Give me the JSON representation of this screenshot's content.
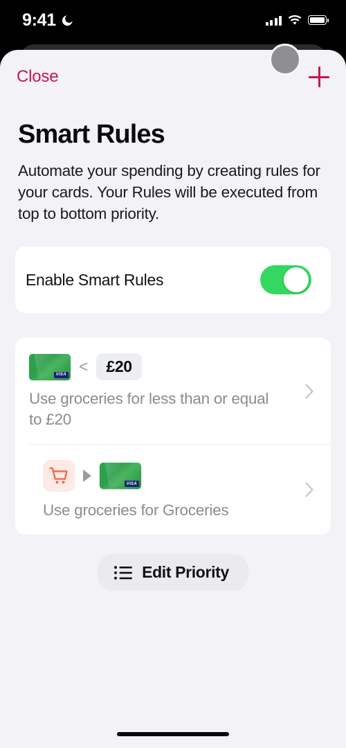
{
  "status_bar": {
    "time": "9:41",
    "dnd_icon": "moon-icon",
    "signal_icon": "cellular-signal-icon",
    "wifi_icon": "wifi-icon",
    "battery_icon": "battery-full-icon"
  },
  "nav": {
    "close_label": "Close",
    "add_icon": "plus-icon",
    "avatar": "user-avatar"
  },
  "header": {
    "title": "Smart Rules",
    "description": "Automate your spending by creating rules for your cards. Your Rules will be executed from top to bottom priority."
  },
  "toggle_section": {
    "label": "Enable Smart Rules",
    "enabled": true,
    "on_color": "#34d860"
  },
  "rules": [
    {
      "card_icon": "green-visa-card-icon",
      "operator": "<",
      "amount": "£20",
      "description": "Use groceries for less than or equal to £20",
      "chevron": "chevron-right-icon"
    },
    {
      "category_icon": "shopping-cart-icon",
      "arrow_icon": "triangle-right-icon",
      "card_icon": "green-visa-card-icon",
      "description": "Use groceries for Groceries",
      "chevron": "chevron-right-icon"
    }
  ],
  "footer": {
    "edit_priority_label": "Edit Priority",
    "edit_priority_icon": "list-bullet-icon"
  },
  "colors": {
    "accent_red": "#c8184b",
    "toggle_green": "#34d860",
    "card_green": "#2ba24a",
    "background": "#f2f2f7",
    "muted_text": "#8b8b91"
  }
}
